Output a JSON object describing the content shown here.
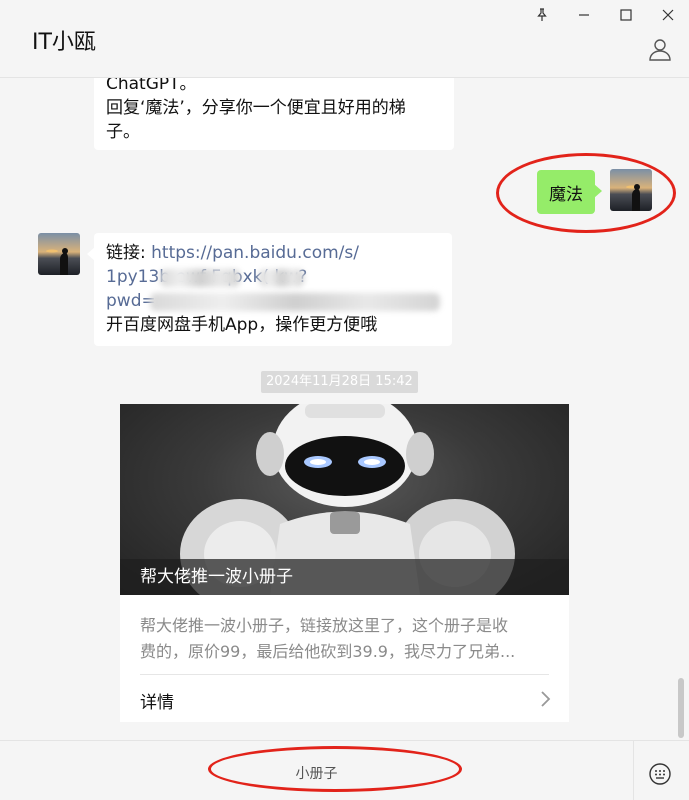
{
  "window": {
    "title": "IT小瓯",
    "controls": [
      "pin-icon",
      "minimize-icon",
      "maximize-icon",
      "close-icon"
    ]
  },
  "messages": {
    "m1": {
      "line1": "ChatGPT。",
      "line2": "回复‘魔法’，分享你一个便宜且好用的梯",
      "line3": "子。"
    },
    "m2": {
      "text": "魔法"
    },
    "m3": {
      "prefix": "链接: ",
      "url": "https://pan.baidu.com/s/",
      "line2": "1py13b        ewf        Fqbxk(   kw?",
      "line3": "pwd=                                      ",
      "line4": "开百度网盘手机App，操作更方便哦"
    },
    "timestamp": "2024年11月28日 15:42",
    "card": {
      "caption": "帮大佬推一波小册子",
      "desc_line1": "帮大佬推一波小册子，链接放这里了，这个册子是收",
      "desc_line2": "费的，原价99，最后给他砍到39.9，我尽力了兄弟...",
      "detail_label": "详情"
    }
  },
  "input": {
    "text": "小册子"
  },
  "colors": {
    "background": "#f5f5f5",
    "sent_bubble": "#95ec69",
    "link": "#576b95",
    "annotation": "#e2231a"
  }
}
